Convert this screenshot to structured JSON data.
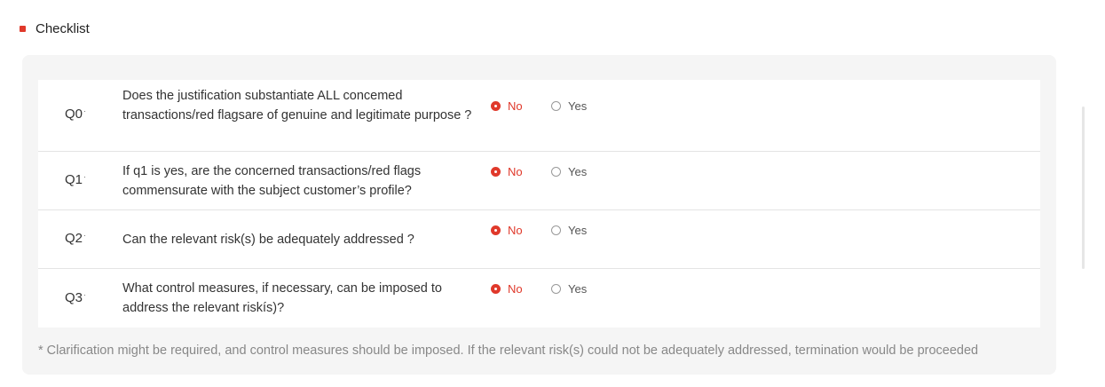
{
  "section": {
    "title": "Checklist"
  },
  "options": {
    "no_label": "No",
    "yes_label": "Yes"
  },
  "questions": [
    {
      "label": "Q0",
      "mark": "·",
      "text": "Does the justification substantiate ALL concemed transactions/red flagsare of genuine and legitimate purpose ?",
      "selected": "No"
    },
    {
      "label": "Q1",
      "mark": "·",
      "text": "If q1 is yes, are the concerned transactions/red flags commensurate with the subject customer’s profile?",
      "selected": "No"
    },
    {
      "label": "Q2",
      "mark": "·",
      "text": "Can the relevant risk(s) be adequately addressed ?",
      "selected": "No"
    },
    {
      "label": "Q3",
      "mark": "·",
      "text": "What control measures, if necessary, can be imposed to address the relevant riskís)?",
      "selected": "No"
    }
  ],
  "footnote": "* Clarification might be required, and control measures should be imposed. If the relevant risk(s) could not be adequately addressed, termination would be proceeded",
  "colors": {
    "accent": "#e0392b",
    "panel_bg": "#f5f5f5",
    "divider": "#e4e4e4"
  }
}
